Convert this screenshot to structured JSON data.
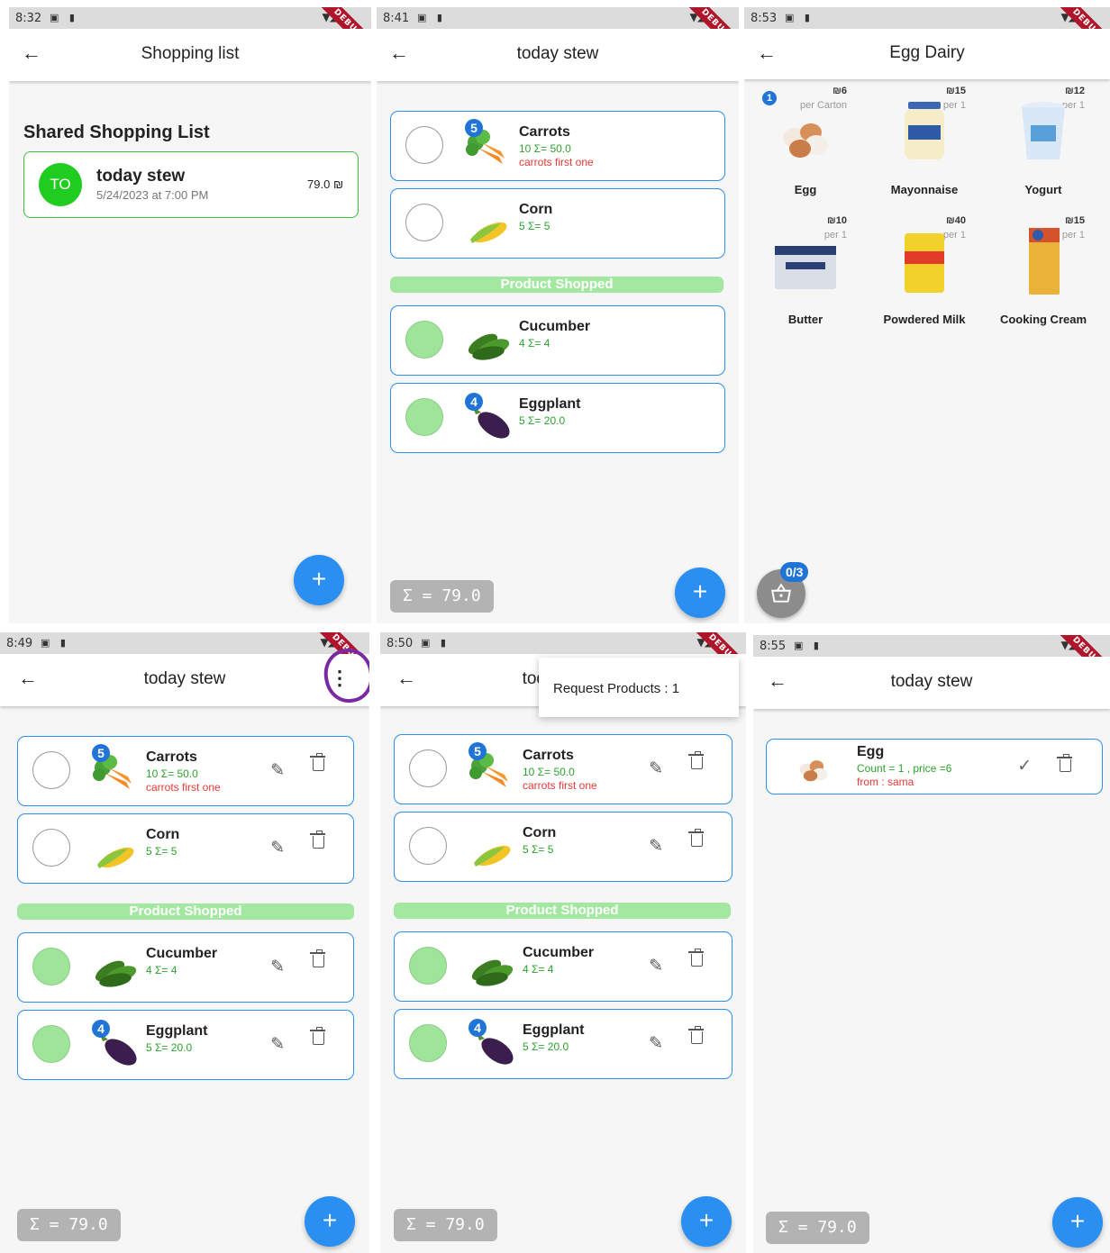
{
  "colors": {
    "accent": "#2a8ff0",
    "shopped": "#a3e8a0",
    "qty_green": "#2ca32c",
    "note_red": "#e53935",
    "badge_blue": "#1f74d6"
  },
  "debug_label": "DEBUG",
  "screen1": {
    "time": "8:32",
    "title": "Shopping list",
    "section": "Shared Shopping List",
    "list": {
      "avatar": "TO",
      "name": "today stew",
      "date": "5/24/2023 at 7:00 PM",
      "total": "79.0 ₪"
    },
    "fab": "+"
  },
  "stew": {
    "title": "today stew",
    "shopped_label": "Product Shopped",
    "total": "Σ = 79.0",
    "fab": "+",
    "pending": [
      {
        "badge": "5",
        "name": "Carrots",
        "qty": "10  Σ= 50.0",
        "note": "carrots first one"
      },
      {
        "badge": "",
        "name": "Corn",
        "qty": "5  Σ= 5",
        "note": ""
      }
    ],
    "shopped": [
      {
        "badge": "",
        "name": "Cucumber",
        "qty": "4  Σ= 4",
        "note": ""
      },
      {
        "badge": "4",
        "name": "Eggplant",
        "qty": "5  Σ= 20.0",
        "note": ""
      }
    ]
  },
  "screen2": {
    "time": "8:41"
  },
  "screen3": {
    "time": "8:53",
    "title": "Egg Dairy",
    "cart_count": "0/3",
    "products": [
      {
        "name": "Egg",
        "price": "₪6",
        "per": "per Carton",
        "badge": "1"
      },
      {
        "name": "Mayonnaise",
        "price": "₪15",
        "per": "per 1",
        "badge": ""
      },
      {
        "name": "Yogurt",
        "price": "₪12",
        "per": "per 1",
        "badge": ""
      },
      {
        "name": "Butter",
        "price": "₪10",
        "per": "per 1",
        "badge": ""
      },
      {
        "name": "Powdered Milk",
        "price": "₪40",
        "per": "per 1",
        "badge": ""
      },
      {
        "name": "Cooking Cream",
        "price": "₪15",
        "per": "per 1",
        "badge": ""
      }
    ]
  },
  "screen4": {
    "time": "8:49"
  },
  "screen5": {
    "time": "8:50",
    "menu_item": "Request Products : 1"
  },
  "screen6": {
    "time": "8:55",
    "title": "today stew",
    "request": {
      "name": "Egg",
      "detail": "Count = 1 , price =6",
      "from": "from : sama"
    },
    "total": "Σ = 79.0",
    "fab": "+"
  }
}
